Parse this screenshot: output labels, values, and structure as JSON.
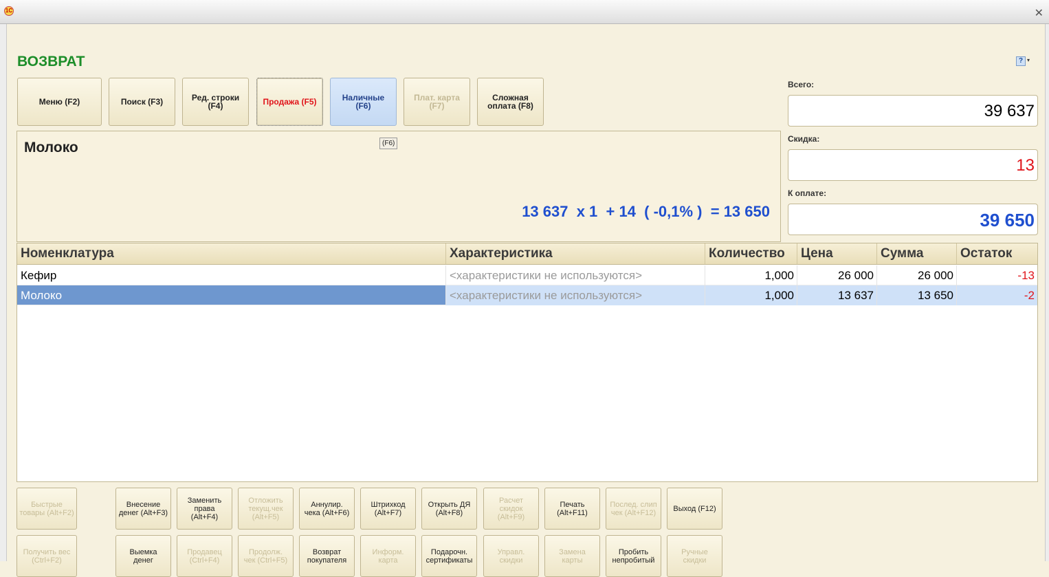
{
  "window": {
    "logo": "1С"
  },
  "page_title": "ВОЗВРАТ",
  "top_buttons": [
    {
      "label": "Меню (F2)"
    },
    {
      "label": "Поиск (F3)"
    },
    {
      "label": "Ред. строки\n(F4)"
    },
    {
      "label": "Продажа (F5)"
    },
    {
      "label": "Наличные\n(F6)"
    },
    {
      "label": "Плат. карта\n(F7)"
    },
    {
      "label": "Сложная\nоплата (F8)"
    }
  ],
  "product": {
    "name": "Молоко",
    "hint": "(F6)",
    "calc": "13 637  x 1  + 14  ( -0,1% )  = 13 650"
  },
  "totals": {
    "total_label": "Всего:",
    "total_value": "39 637",
    "discount_label": "Скидка:",
    "discount_value": "13",
    "pay_label": "К оплате:",
    "pay_value": "39 650",
    "colors": {
      "discount": "#e0141a",
      "pay": "#1f4fcf"
    }
  },
  "grid": {
    "columns": [
      "Номенклатура",
      "Характеристика",
      "Количество",
      "Цена",
      "Сумма",
      "Остаток"
    ],
    "rows": [
      {
        "name": "Кефир",
        "characteristic": "<характеристики не используются>",
        "qty": "1,000",
        "price": "26 000",
        "sum": "26 000",
        "rest": "-13",
        "selected": false
      },
      {
        "name": "Молоко",
        "characteristic": "<характеристики не используются>",
        "qty": "1,000",
        "price": "13 637",
        "sum": "13 650",
        "rest": "-2",
        "selected": true
      }
    ]
  },
  "function_buttons_row1": [
    {
      "label": "Быстрые\nтовары (Alt+F2)",
      "enabled": false
    },
    {
      "label": "Внесение\nденег (Alt+F3)",
      "enabled": true
    },
    {
      "label": "Заменить\nправа\n(Alt+F4)",
      "enabled": true
    },
    {
      "label": "Отложить\nтекущ.чек\n(Alt+F5)",
      "enabled": false
    },
    {
      "label": "Аннулир.\nчека (Alt+F6)",
      "enabled": true
    },
    {
      "label": "Штрихкод\n(Alt+F7)",
      "enabled": true
    },
    {
      "label": "Открыть ДЯ\n(Alt+F8)",
      "enabled": true
    },
    {
      "label": "Расчет\nскидок\n(Alt+F9)",
      "enabled": false
    },
    {
      "label": "Печать\n(Alt+F11)",
      "enabled": true
    },
    {
      "label": "Послед. слип\nчек (Alt+F12)",
      "enabled": false
    },
    {
      "label": "Выход (F12)",
      "enabled": true
    }
  ],
  "function_buttons_row2": [
    {
      "label": "Получить вес\n(Ctrl+F2)",
      "enabled": false
    },
    {
      "label": "Выемка\nденег",
      "enabled": true
    },
    {
      "label": "Продавец\n(Ctrl+F4)",
      "enabled": false
    },
    {
      "label": "Продолж.\nчек (Ctrl+F5)",
      "enabled": false
    },
    {
      "label": "Возврат\nпокупателя",
      "enabled": true
    },
    {
      "label": "Информ.\nкарта",
      "enabled": false
    },
    {
      "label": "Подарочн.\nсертификаты",
      "enabled": true
    },
    {
      "label": "Управл.\nскидки",
      "enabled": false
    },
    {
      "label": "Замена\nкарты",
      "enabled": false
    },
    {
      "label": "Пробить\nнепробитый",
      "enabled": true
    },
    {
      "label": "Ручные\nскидки",
      "enabled": false
    }
  ]
}
